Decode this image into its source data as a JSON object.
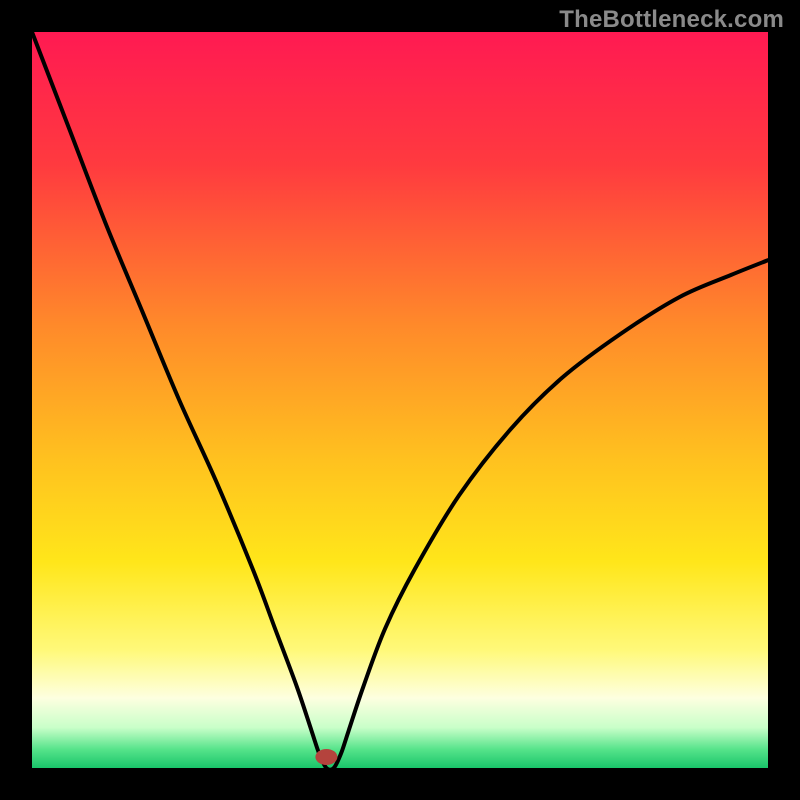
{
  "watermark": "TheBottleneck.com",
  "chart_data": {
    "type": "line",
    "title": "",
    "xlabel": "",
    "ylabel": "",
    "xlim": [
      0,
      100
    ],
    "ylim": [
      0,
      100
    ],
    "optimum_x": 40,
    "series": [
      {
        "name": "bottleneck-curve",
        "x": [
          0,
          5,
          10,
          15,
          20,
          25,
          30,
          33,
          36,
          38,
          39,
          40,
          41,
          42,
          43,
          45,
          48,
          52,
          58,
          65,
          72,
          80,
          88,
          95,
          100
        ],
        "y": [
          100,
          87,
          74,
          62,
          50,
          39,
          27,
          19,
          11,
          5,
          2,
          0,
          0,
          2,
          5,
          11,
          19,
          27,
          37,
          46,
          53,
          59,
          64,
          67,
          69
        ]
      }
    ],
    "marker": {
      "x": 40,
      "y": 1.5
    },
    "gradient_stops": [
      {
        "offset": 0.0,
        "color": "#ff1a52"
      },
      {
        "offset": 0.18,
        "color": "#ff3a3f"
      },
      {
        "offset": 0.4,
        "color": "#ff8a2a"
      },
      {
        "offset": 0.58,
        "color": "#ffc11f"
      },
      {
        "offset": 0.72,
        "color": "#ffe61a"
      },
      {
        "offset": 0.84,
        "color": "#fff97a"
      },
      {
        "offset": 0.905,
        "color": "#fdffe0"
      },
      {
        "offset": 0.945,
        "color": "#c9ffc9"
      },
      {
        "offset": 0.975,
        "color": "#55e38a"
      },
      {
        "offset": 1.0,
        "color": "#19c56a"
      }
    ],
    "marker_color": "#b4433d",
    "curve_color": "#000000"
  }
}
